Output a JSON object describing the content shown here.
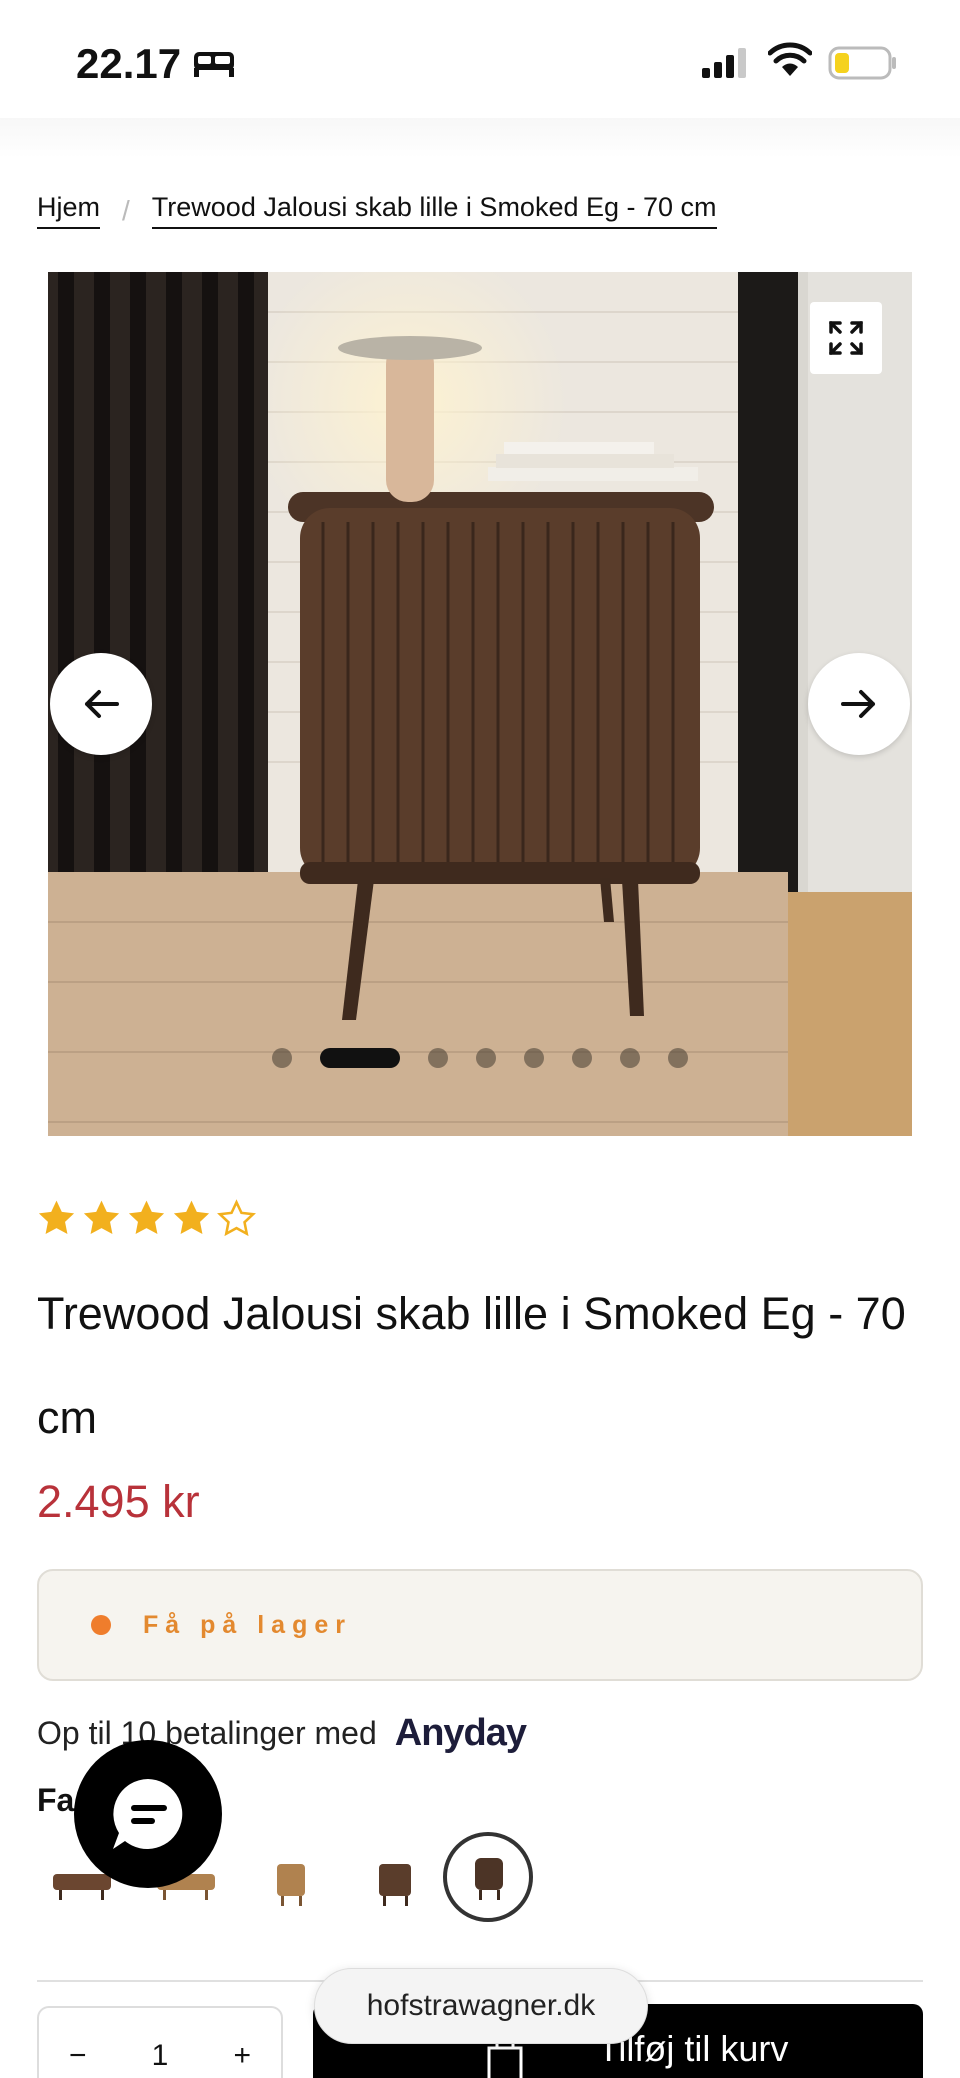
{
  "status_bar": {
    "time": "22.17",
    "icons": [
      "bed-icon",
      "signal-icon",
      "wifi-icon",
      "battery-icon"
    ]
  },
  "breadcrumb": {
    "items": [
      "Hjem",
      "Trewood Jalousi skab lille i Smoked Eg - 70 cm"
    ],
    "separator": "/"
  },
  "gallery": {
    "image_count": 9,
    "active_index": 1,
    "controls": [
      "expand-icon",
      "arrow-left-icon",
      "arrow-right-icon"
    ]
  },
  "product": {
    "rating": 4,
    "rating_max": 5,
    "title": "Trewood Jalousi skab lille i Smoked Eg - 70 cm",
    "price": "2.495 kr",
    "stock_text": "Få på lager",
    "payment_text": "Op til 10 betalinger med",
    "payment_brand": "Anyday",
    "color_label": "Fa",
    "variants_count": 5,
    "selected_variant": 4
  },
  "purchase": {
    "qty_minus": "−",
    "qty_value": "1",
    "qty_plus": "+",
    "add_to_cart": "Tilføj til kurv"
  },
  "browser": {
    "url": "hofstrawagner.dk"
  },
  "colors": {
    "price": "#b8323a",
    "stock": "#e3892f",
    "star": "#f2b01e"
  }
}
